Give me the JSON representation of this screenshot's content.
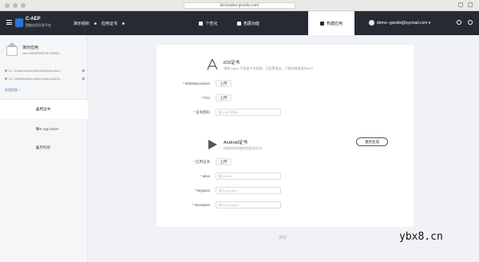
{
  "browser": {
    "url": "devmaker.gizwits.com"
  },
  "header": {
    "brand": "C-AEP",
    "brand_sub": "智能应用开发平台",
    "breadcrumbs": [
      "演示组织",
      "应用证书"
    ],
    "tabs": [
      {
        "label": "个性化",
        "active": false
      },
      {
        "label": "拓展功能",
        "active": false
      },
      {
        "label": "构建应用",
        "active": true
      }
    ],
    "account": "demo--gizwits@sycmail.com ▾"
  },
  "sidebar": {
    "project_name": "演示应用",
    "project_id": "com.DEMO09DTE.DEMO...",
    "keys": [
      {
        "label": "ID: 1bfa6f0e09ab4f90d4f95bb1c8ba..."
      },
      {
        "label": "ID: 1596f8c8d6fe4a5e3d48a1d3b3a..."
      }
    ],
    "info_link": "应用信息 >",
    "menu": [
      {
        "label": "应用证书",
        "active": true
      },
      {
        "label": "iOS App Store",
        "active": false
      },
      {
        "label": "应用构建",
        "active": false
      }
    ]
  },
  "ios": {
    "title": "iOS证书",
    "subtitle": "请按 Apple 开发者平台获取，可配置推送，只能同域使用的APP",
    "fields": [
      {
        "label": "Mobileprovision",
        "required": true,
        "button": "上传"
      },
      {
        "label": "P12",
        "required": true,
        "button": "上传"
      },
      {
        "label": "证书密码",
        "required": true,
        "placeholder": "输入证书密码"
      }
    ]
  },
  "android": {
    "title": "Android证书",
    "subtitle": "构建应用时使用的签名证书",
    "reset_label": "重新生成",
    "fields": [
      {
        "label": "应用证书",
        "required": true,
        "button": "上传"
      },
      {
        "label": "alias",
        "required": true,
        "placeholder": "输入alias"
      },
      {
        "label": "keypass",
        "required": true,
        "placeholder": "输入keypass"
      },
      {
        "label": "storepass",
        "required": true,
        "placeholder": "输入storepass"
      }
    ]
  },
  "footer": {
    "save_label": "保存"
  },
  "watermark": "ybx8.cn",
  "colors": {
    "appbar": "#262b33",
    "accent": "#2d74d6",
    "required": "#e14d4d"
  }
}
